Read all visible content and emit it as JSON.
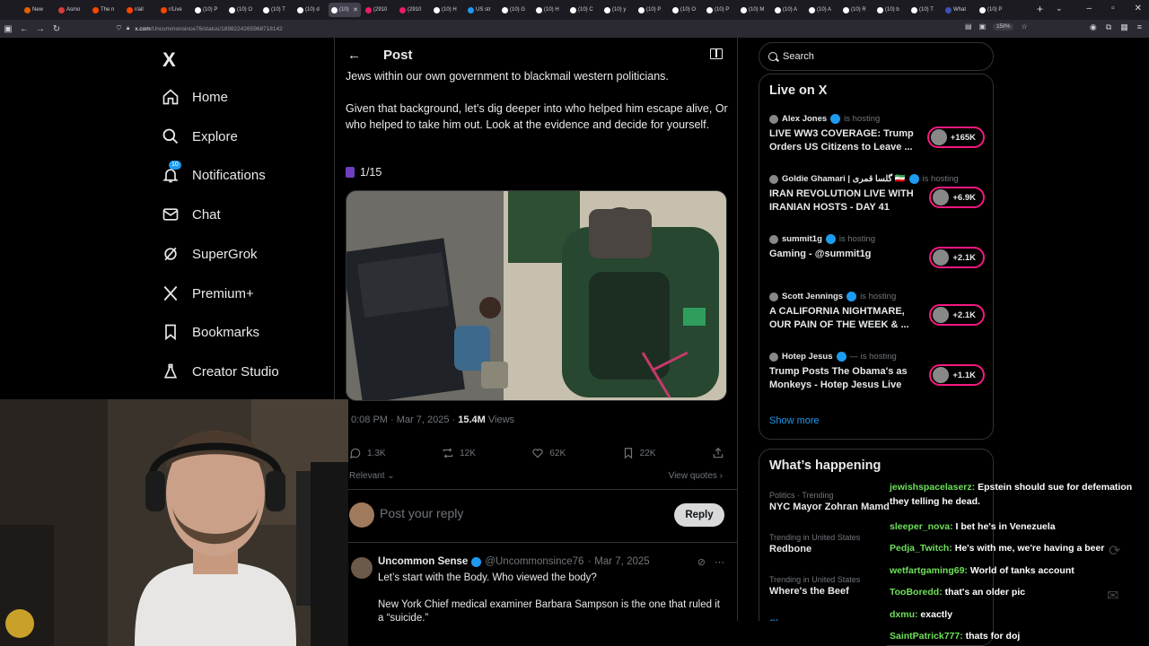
{
  "browser": {
    "tabs": [
      {
        "label": "New",
        "icon": "firefox-icon",
        "color": "#e66000"
      },
      {
        "label": "Asmo",
        "icon": "pin-icon",
        "color": "#d93d3d"
      },
      {
        "label": "The n",
        "icon": "reddit-icon",
        "color": "#ff4500"
      },
      {
        "label": "r/all",
        "icon": "reddit-icon",
        "color": "#ff4500"
      },
      {
        "label": "r/Live",
        "icon": "reddit-icon",
        "color": "#ff4500"
      },
      {
        "label": "(10) P",
        "icon": "x-icon",
        "color": "#ffffff"
      },
      {
        "label": "(10) O",
        "icon": "x-icon",
        "color": "#ffffff"
      },
      {
        "label": "(10) T",
        "icon": "x-icon",
        "color": "#ffffff"
      },
      {
        "label": "(10) d",
        "icon": "x-icon",
        "color": "#ffffff"
      },
      {
        "label": "(10)",
        "icon": "x-icon",
        "color": "#ffffff",
        "active": true
      },
      {
        "label": "(2910",
        "icon": "twitch-icon",
        "color": "#e91e63"
      },
      {
        "label": "(2910",
        "icon": "twitch-icon",
        "color": "#e91e63"
      },
      {
        "label": "(10) H",
        "icon": "x-icon",
        "color": "#ffffff"
      },
      {
        "label": "US str",
        "icon": "news-icon",
        "color": "#2196f3"
      },
      {
        "label": "(10) G",
        "icon": "x-icon",
        "color": "#ffffff"
      },
      {
        "label": "(10) H",
        "icon": "x-icon",
        "color": "#ffffff"
      },
      {
        "label": "(10) C",
        "icon": "x-icon",
        "color": "#ffffff"
      },
      {
        "label": "(10) y",
        "icon": "x-icon",
        "color": "#ffffff"
      },
      {
        "label": "(10) P",
        "icon": "x-icon",
        "color": "#ffffff"
      },
      {
        "label": "(10) O",
        "icon": "x-icon",
        "color": "#ffffff"
      },
      {
        "label": "(10) P",
        "icon": "x-icon",
        "color": "#ffffff"
      },
      {
        "label": "(10) M",
        "icon": "x-icon",
        "color": "#ffffff"
      },
      {
        "label": "(10) A",
        "icon": "x-icon",
        "color": "#ffffff"
      },
      {
        "label": "(10) A",
        "icon": "x-icon",
        "color": "#ffffff"
      },
      {
        "label": "(10) R",
        "icon": "x-icon",
        "color": "#ffffff"
      },
      {
        "label": "(10) b",
        "icon": "x-icon",
        "color": "#ffffff"
      },
      {
        "label": "(10) T",
        "icon": "x-icon",
        "color": "#ffffff"
      },
      {
        "label": "What",
        "icon": "news-icon",
        "color": "#3f51b5"
      },
      {
        "label": "(10) P",
        "icon": "x-icon",
        "color": "#ffffff"
      }
    ],
    "url_domain": "x.com",
    "url_path": "/Uncommonsince76/status/1898224265968718142",
    "zoom": "150%"
  },
  "leftnav": {
    "logo": "X",
    "items": [
      {
        "label": "Home",
        "icon": "home-icon"
      },
      {
        "label": "Explore",
        "icon": "search-icon"
      },
      {
        "label": "Notifications",
        "icon": "bell-icon",
        "badge": "10"
      },
      {
        "label": "Chat",
        "icon": "mail-icon"
      },
      {
        "label": "SuperGrok",
        "icon": "grok-icon"
      },
      {
        "label": "Premium+",
        "icon": "x-icon"
      },
      {
        "label": "Bookmarks",
        "icon": "bookmark-icon"
      },
      {
        "label": "Creator Studio",
        "icon": "flask-icon"
      }
    ]
  },
  "post": {
    "header_title": "Post",
    "text_line0": "Jews within our own government to blackmail western politicians.",
    "text_para": "Given that background, let’s dig deeper into who helped him escape alive, Or who helped to take him out. Look at the evidence and decide for yourself.",
    "thread_count": "1/15",
    "time": "0:08 PM",
    "date": "Mar 7, 2025",
    "views_count": "15.4M",
    "views_label": "Views",
    "replies": "1.3K",
    "reposts": "12K",
    "likes": "62K",
    "bookmarks": "22K",
    "sort_label": "Relevant",
    "view_quotes": "View quotes",
    "reply_placeholder": "Post your reply",
    "reply_button": "Reply"
  },
  "comment": {
    "name": "Uncommon Sense",
    "handle": "@Uncommonsince76",
    "date": "Mar 7, 2025",
    "line1": "Let’s start with the Body. Who viewed the body?",
    "line2": "New York Chief medical examiner Barbara Sampson is the one that ruled it a “suicide.”"
  },
  "search": {
    "placeholder": "Search"
  },
  "live": {
    "title": "Live on X",
    "items": [
      {
        "host": "Alex Jones",
        "hosting": "is hosting",
        "title": "LIVE WW3 COVERAGE: Trump Orders US Citizens to Leave ...",
        "count": "+165K"
      },
      {
        "host": "Goldie Ghamari | گلسا قمری 🇮🇷",
        "hosting": "is hosting",
        "title": "IRAN REVOLUTION LIVE WITH IRANIAN HOSTS - DAY 41",
        "count": "+6.9K"
      },
      {
        "host": "summit1g",
        "hosting": "is hosting",
        "title": "Gaming - @summit1g",
        "count": "+2.1K"
      },
      {
        "host": "Scott Jennings",
        "hosting": "is hosting",
        "title": "A CALIFORNIA NIGHTMARE, OUR PAIN OF THE WEEK & ...",
        "count": "+2.1K"
      },
      {
        "host": "Hotep Jesus",
        "hosting": "— is hosting",
        "title": "Trump Posts The Obama's as Monkeys - Hotep Jesus Live",
        "count": "+1.1K"
      }
    ],
    "show_more": "Show more"
  },
  "happening": {
    "title": "What’s happening",
    "trends": [
      {
        "context": "Politics · Trending",
        "title": "NYC Mayor Zohran Mamd"
      },
      {
        "context": "Trending in United States",
        "title": "Redbone"
      },
      {
        "context": "Trending in United States",
        "title": "Where's the Beef"
      }
    ],
    "show_more": "Show more"
  },
  "chat": [
    {
      "user": "jewishspacelaserz:",
      "msg": "Epstein should sue for defemation they telling he dead."
    },
    {
      "user": "sleeper_nova:",
      "msg": "I bet he's in Venezuela"
    },
    {
      "user": "Pedja_Twitch:",
      "msg": "He's with me, we're having a beer"
    },
    {
      "user": "wetfartgaming69:",
      "msg": "World of tanks account"
    },
    {
      "user": "TooBoredd:",
      "msg": "that's an older pic"
    },
    {
      "user": "dxmu:",
      "msg": "exactly"
    },
    {
      "user": "SaintPatrick777:",
      "msg": "thats for doj"
    }
  ],
  "colors": {
    "accent": "#1d9bf0",
    "live_ring": "#f91880",
    "chat_user": "#6ee05a"
  }
}
